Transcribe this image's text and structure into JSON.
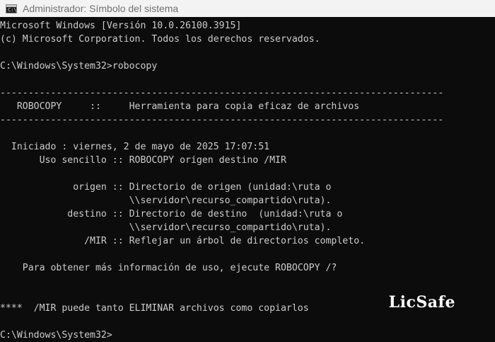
{
  "window": {
    "title": "Administrador: Símbolo del sistema",
    "icon": "command-prompt-icon"
  },
  "console": {
    "lines": [
      "Microsoft Windows [Versión 10.0.26100.3915]",
      "(c) Microsoft Corporation. Todos los derechos reservados.",
      "",
      "C:\\Windows\\System32>robocopy",
      "",
      "-------------------------------------------------------------------------------",
      "   ROBOCOPY     ::     Herramienta para copia eficaz de archivos",
      "-------------------------------------------------------------------------------",
      "",
      "  Iniciado : viernes, 2 de mayo de 2025 17:07:51",
      "       Uso sencillo :: ROBOCOPY origen destino /MIR",
      "",
      "             origen :: Directorio de origen (unidad:\\ruta o",
      "                       \\\\servidor\\recurso_compartido\\ruta).",
      "            destino :: Directorio de destino  (unidad:\\ruta o",
      "                       \\\\servidor\\recurso_compartido\\ruta).",
      "               /MIR :: Reflejar un árbol de directorios completo.",
      "",
      "    Para obtener más información de uso, ejecute ROBOCOPY /?",
      "",
      "",
      "****  /MIR puede tanto ELIMINAR archivos como copiarlos",
      "",
      "C:\\Windows\\System32>"
    ]
  },
  "watermark": "LicSafe"
}
